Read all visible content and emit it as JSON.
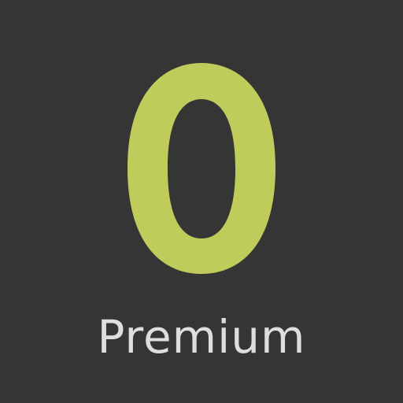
{
  "app_icon": {
    "letter": "O",
    "label": "Premium"
  },
  "colors": {
    "background": "#353535",
    "letter": "#bfcb5b",
    "label": "#dedede"
  }
}
